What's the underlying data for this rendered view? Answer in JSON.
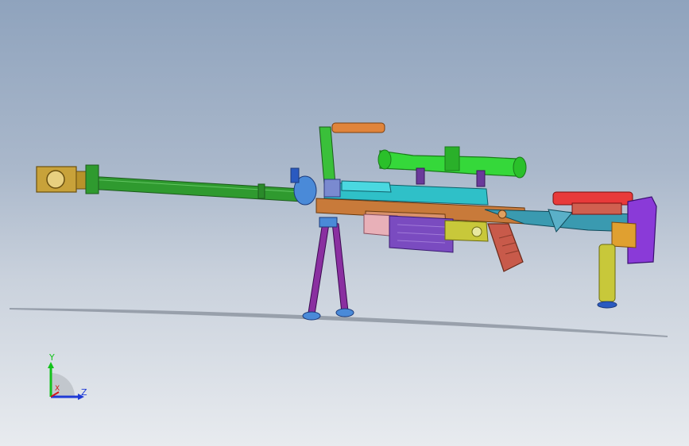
{
  "viewport": {
    "background_top": "#8fa3bd",
    "background_bottom": "#e8ebef"
  },
  "model": {
    "part_colors": {
      "barrel": "#2f9a2f",
      "muzzle_brake": "#c8a23a",
      "scope": "#35d83a",
      "receiver": "#c87a3a",
      "rail": "#2fc0c8",
      "magazine": "#7a4bc0",
      "bipod_legs": "#8a2fa0",
      "bipod_mount": "#4a8ad8",
      "grip": "#c85a4a",
      "trigger_guard": "#c8c83a",
      "stock_frame": "#3a9ab0",
      "cheek_rest": "#e83a3a",
      "butt_pad": "#8a3ad8",
      "monopod": "#c8c83a",
      "carry_handle": "#e0843a"
    }
  },
  "triad": {
    "y_label": "Y",
    "x_label": "X",
    "z_label": "Z",
    "y_color": "#13c21b",
    "x_color": "#d11a1a",
    "z_color": "#1e3ad6"
  }
}
